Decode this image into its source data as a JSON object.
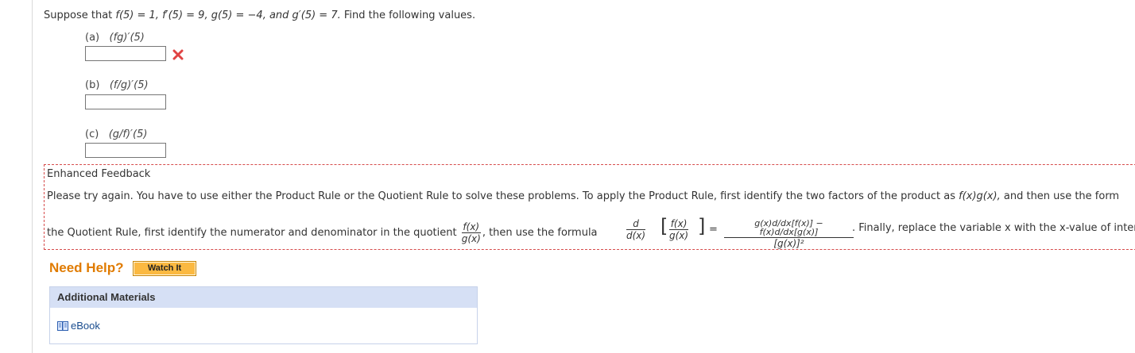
{
  "question": {
    "lead": "Suppose that ",
    "given": "f(5) = 1, f′(5) = 9, g(5) = −4, and g′(5) = 7.",
    "prompt": " Find the following values."
  },
  "parts": [
    {
      "label": "(a)",
      "expr": "(fg)′(5)",
      "value": "",
      "status": "incorrect"
    },
    {
      "label": "(b)",
      "expr": "(f/g)′(5)",
      "value": ""
    },
    {
      "label": "(c)",
      "expr": "(g/f)′(5)",
      "value": ""
    }
  ],
  "feedback": {
    "title": "Enhanced Feedback",
    "line1_a": "Please try again. You have to use either the Product Rule or the Quotient Rule to solve these problems. To apply the Product Rule, first identify the two factors of the product as ",
    "line1_expr": "f(x)g(x),",
    "line1_b": " and then use the form",
    "line2_a": "the Quotient Rule, first identify the numerator and denominator in the quotient ",
    "quot_num": "f(x)",
    "quot_den": "g(x)",
    "line2_b": ", then use the formula",
    "d_num": "d",
    "d_den": "d(x)",
    "br_num": "f(x)",
    "br_den": "g(x)",
    "eq": "=",
    "rhs_num": "g(x)d/dx[f(x)] − f(x)d/dx[g(x)]",
    "rhs_den": "[g(x)]²",
    "line2_c": ". Finally, replace the variable x with the x-value of inter"
  },
  "help": {
    "title": "Need Help?",
    "watch_label": "Watch It"
  },
  "materials": {
    "heading": "Additional Materials",
    "ebook": "eBook"
  },
  "colors": {
    "error": "#e04343",
    "accent": "#e07b00",
    "button": "#fbb941"
  }
}
